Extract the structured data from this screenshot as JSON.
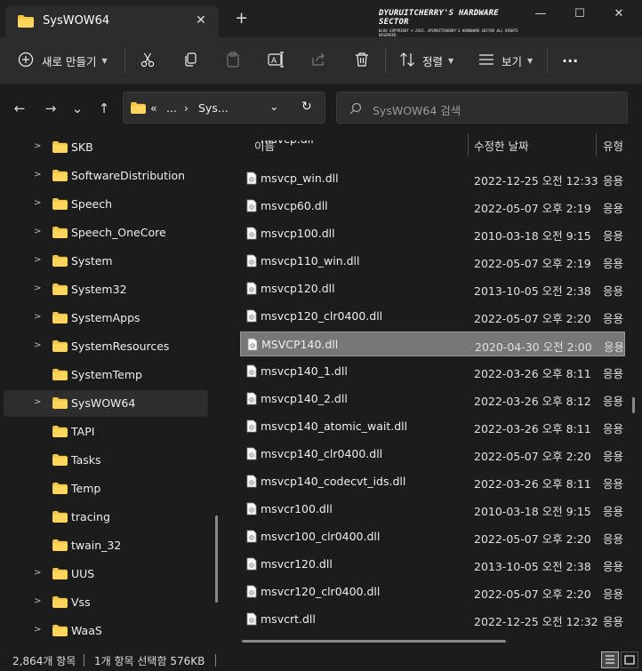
{
  "window": {
    "tab_title": "SysWOW64",
    "tab_close": "✕",
    "new_tab": "+",
    "watermark_title": "DYURUITCHERRY'S HARDWARE SECTOR",
    "watermark_sub": "BLOG COPYRIGHT © 2013. DYURUITCHERRY'S HARDWARE SECTOR ALL RIGHTS RESERVED.",
    "minimize": "—",
    "maximize": "☐",
    "close": "✕"
  },
  "toolbar": {
    "new_label": "새로 만들기",
    "sort_label": "정렬",
    "view_label": "보기",
    "more_label": "···",
    "icons": [
      "plus-circle-icon",
      "cut-icon",
      "copy-icon",
      "paste-icon",
      "rename-icon",
      "share-icon",
      "delete-icon",
      "sort-icon",
      "view-icon",
      "more-icon"
    ]
  },
  "address": {
    "back": "←",
    "forward": "→",
    "recent": "⌄",
    "up": "↑",
    "overflow": "«",
    "ellipsis": "...",
    "separator": "›",
    "current": "Sys...",
    "dropdown": "⌄",
    "refresh": "↻",
    "search_placeholder": "SysWOW64 검색"
  },
  "sidebar": {
    "items": [
      {
        "label": "SKB",
        "expandable": true
      },
      {
        "label": "SoftwareDistribution",
        "expandable": true
      },
      {
        "label": "Speech",
        "expandable": true
      },
      {
        "label": "Speech_OneCore",
        "expandable": true
      },
      {
        "label": "System",
        "expandable": true
      },
      {
        "label": "System32",
        "expandable": true
      },
      {
        "label": "SystemApps",
        "expandable": true
      },
      {
        "label": "SystemResources",
        "expandable": true
      },
      {
        "label": "SystemTemp",
        "expandable": false
      },
      {
        "label": "SysWOW64",
        "expandable": true,
        "active": true
      },
      {
        "label": "TAPI",
        "expandable": false
      },
      {
        "label": "Tasks",
        "expandable": false
      },
      {
        "label": "Temp",
        "expandable": false
      },
      {
        "label": "tracing",
        "expandable": false
      },
      {
        "label": "twain_32",
        "expandable": false
      },
      {
        "label": "UUS",
        "expandable": true
      },
      {
        "label": "Vss",
        "expandable": true
      },
      {
        "label": "WaaS",
        "expandable": true
      }
    ]
  },
  "columns": {
    "name": "이름",
    "modified": "수정한 날짜",
    "type": "유형",
    "sort_indicator": "^"
  },
  "files": [
    {
      "name": "msvcp_win.dll",
      "date": "2022-12-25 오전 12:33",
      "type": "응용"
    },
    {
      "name": "msvcp60.dll",
      "date": "2022-05-07 오후 2:19",
      "type": "응용"
    },
    {
      "name": "msvcp100.dll",
      "date": "2010-03-18 오전 9:15",
      "type": "응용"
    },
    {
      "name": "msvcp110_win.dll",
      "date": "2022-05-07 오후 2:19",
      "type": "응용"
    },
    {
      "name": "msvcp120.dll",
      "date": "2013-10-05 오전 2:38",
      "type": "응용"
    },
    {
      "name": "msvcp120_clr0400.dll",
      "date": "2022-05-07 오후 2:20",
      "type": "응용"
    },
    {
      "name": "MSVCP140.dll",
      "date": "2020-04-30 오전 2:00",
      "type": "응용",
      "selected": true
    },
    {
      "name": "msvcp140_1.dll",
      "date": "2022-03-26 오후 8:11",
      "type": "응용"
    },
    {
      "name": "msvcp140_2.dll",
      "date": "2022-03-26 오후 8:12",
      "type": "응용"
    },
    {
      "name": "msvcp140_atomic_wait.dll",
      "date": "2022-03-26 오후 8:11",
      "type": "응용"
    },
    {
      "name": "msvcp140_clr0400.dll",
      "date": "2022-05-07 오후 2:20",
      "type": "응용"
    },
    {
      "name": "msvcp140_codecvt_ids.dll",
      "date": "2022-03-26 오후 8:11",
      "type": "응용"
    },
    {
      "name": "msvcr100.dll",
      "date": "2010-03-18 오전 9:15",
      "type": "응용"
    },
    {
      "name": "msvcr100_clr0400.dll",
      "date": "2022-05-07 오후 2:20",
      "type": "응용"
    },
    {
      "name": "msvcr120.dll",
      "date": "2013-10-05 오전 2:38",
      "type": "응용"
    },
    {
      "name": "msvcr120_clr0400.dll",
      "date": "2022-05-07 오후 2:20",
      "type": "응용"
    },
    {
      "name": "msvcrt.dll",
      "date": "2022-12-25 오전 12:32",
      "type": "응용"
    }
  ],
  "status": {
    "item_count": "2,864개 항목",
    "selection": "1개 항목 선택함 576KB"
  }
}
